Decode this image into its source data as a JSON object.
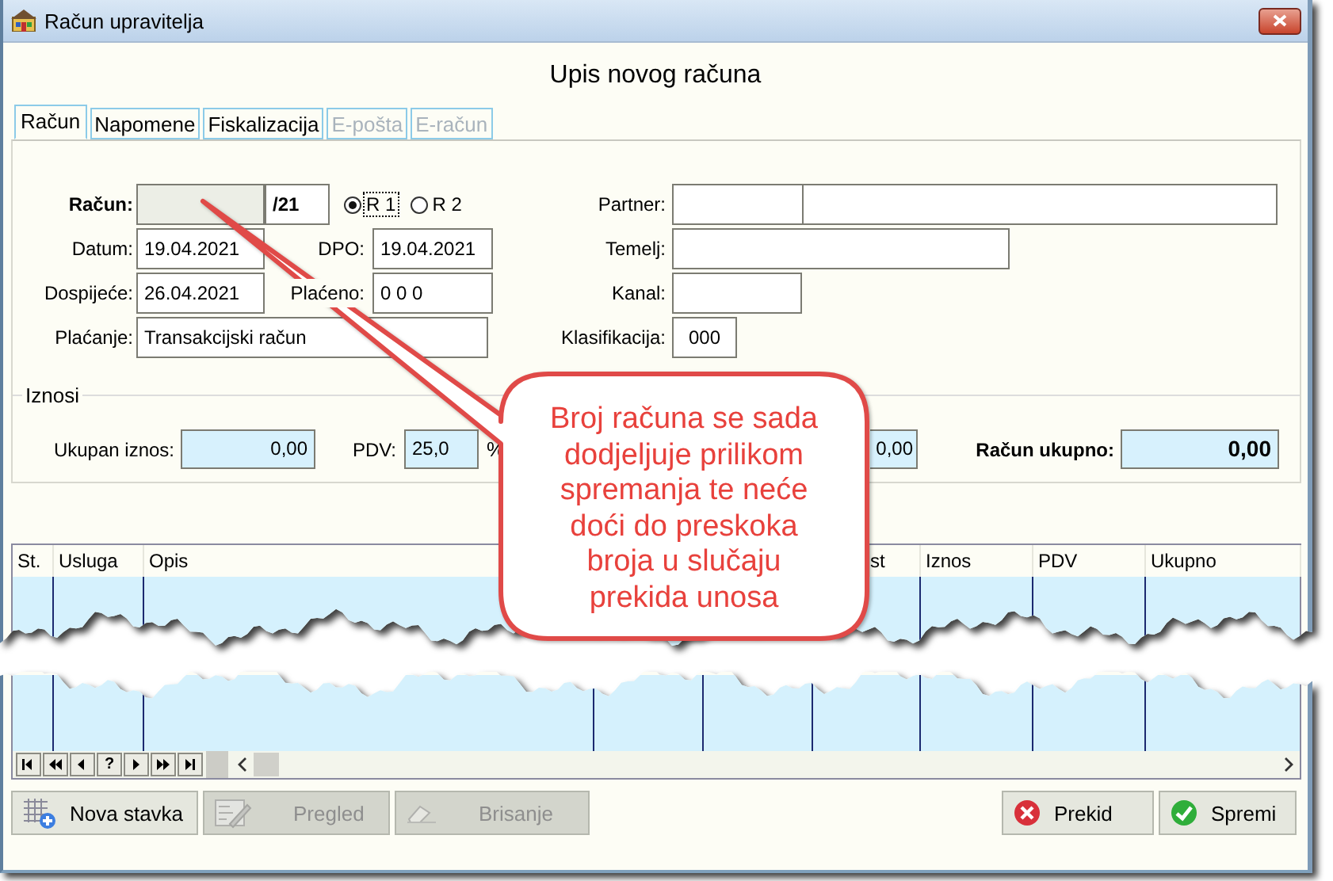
{
  "window": {
    "title": "Račun upravitelja"
  },
  "heading": "Upis novog računa",
  "tabs": [
    {
      "label": "Račun",
      "selected": true,
      "disabled": false
    },
    {
      "label": "Napomene",
      "selected": false,
      "disabled": false
    },
    {
      "label": "Fiskalizacija",
      "selected": false,
      "disabled": false
    },
    {
      "label": "E-pošta",
      "selected": false,
      "disabled": true
    },
    {
      "label": "E-račun",
      "selected": false,
      "disabled": true
    }
  ],
  "form": {
    "invoice": {
      "label": "Račun:",
      "suffix": "/21"
    },
    "invoice_type": [
      {
        "label": "R 1",
        "selected": true
      },
      {
        "label": "R 2",
        "selected": false
      }
    ],
    "date": {
      "label": "Datum:",
      "value": "19.04.2021"
    },
    "dpo": {
      "label": "DPO:",
      "value": "19.04.2021"
    },
    "due_date": {
      "label": "Dospijeće:",
      "value": "26.04.2021"
    },
    "paid": {
      "label": "Plaćeno:",
      "value": "0 0  0"
    },
    "payment": {
      "label": "Plaćanje:",
      "value": "Transakcijski račun"
    },
    "partner": {
      "label": "Partner:"
    },
    "basis": {
      "label": "Temelj:"
    },
    "channel": {
      "label": "Kanal:"
    },
    "classification": {
      "label": "Klasifikacija:",
      "value": "000"
    }
  },
  "amounts": {
    "title": "Iznosi",
    "total": {
      "label": "Ukupan iznos:",
      "value": "0,00"
    },
    "vat": {
      "label": "PDV:",
      "value": "25,0",
      "unit": "%"
    },
    "field_3": {
      "value": "0,00"
    },
    "grand_total": {
      "label": "Račun ukupno:",
      "value": "0,00"
    }
  },
  "table": {
    "columns": [
      "St.",
      "Usluga",
      "Opis",
      "st",
      "Iznos",
      "PDV",
      "Ukupno"
    ]
  },
  "navigator": [
    {
      "kind": "first"
    },
    {
      "kind": "prev-page"
    },
    {
      "kind": "prev"
    },
    {
      "kind": "help",
      "label": "?"
    },
    {
      "kind": "next"
    },
    {
      "kind": "next-page"
    },
    {
      "kind": "last"
    }
  ],
  "buttons": [
    {
      "label": "Nova stavka",
      "kind": "add",
      "disabled": false
    },
    {
      "label": "Pregled",
      "kind": "view",
      "disabled": true
    },
    {
      "label": "Brisanje",
      "kind": "erase",
      "disabled": true
    },
    {
      "label": "Prekid",
      "kind": "cancel",
      "disabled": false
    },
    {
      "label": "Spremi",
      "kind": "save",
      "disabled": false
    }
  ],
  "callout": {
    "text": "Broj računa se sada dodjeljuje prilikom spremanja te neće doći do preskoka broja u slučaju prekida unosa"
  }
}
